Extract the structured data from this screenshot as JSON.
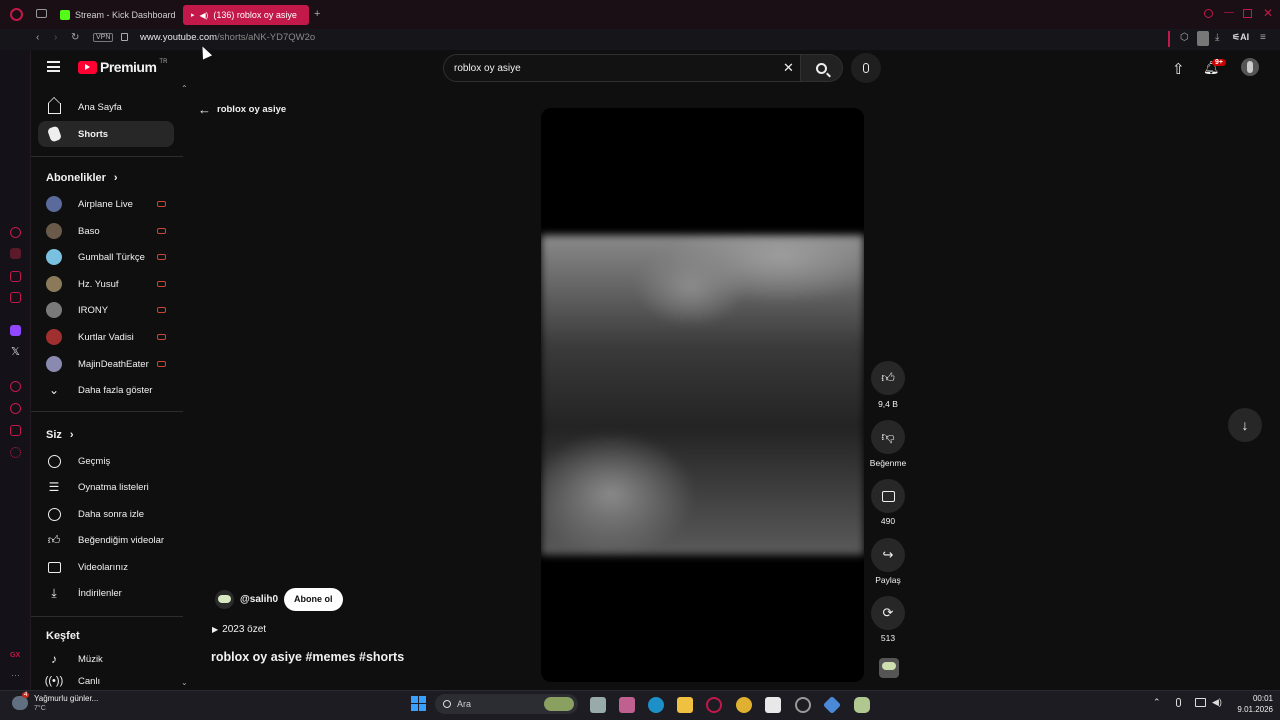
{
  "browser": {
    "tabs": [
      {
        "title": "Stream - Kick Dashboard"
      },
      {
        "title": "(136) roblox oy asiye"
      }
    ],
    "vpn_label": "VPN",
    "url_host": "www.youtube.com",
    "url_path": "/shorts/aNK-YD7QW2o",
    "ai_label": "AI"
  },
  "header": {
    "logo_text": "Premium",
    "logo_region": "TR",
    "search_value": "roblox oy asiye",
    "notification_count": "9+"
  },
  "sidebar": {
    "items": [
      {
        "label": "Ana Sayfa"
      },
      {
        "label": "Shorts"
      }
    ],
    "subscriptions_title": "Abonelikler",
    "subscriptions": [
      {
        "label": "Airplane Live",
        "color": "#5a6a9a"
      },
      {
        "label": "Baso",
        "color": "#6a5a4a"
      },
      {
        "label": "Gumball Türkçe",
        "color": "#7ac0e0"
      },
      {
        "label": "Hz. Yusuf",
        "color": "#8a7a5a"
      },
      {
        "label": "IRONY",
        "color": "#7a7a7a"
      },
      {
        "label": "Kurtlar Vadisi",
        "color": "#a03030"
      },
      {
        "label": "MajinDeathEater",
        "color": "#8a8ab0"
      }
    ],
    "show_more": "Daha fazla göster",
    "you_title": "Siz",
    "you_items": [
      {
        "label": "Geçmiş"
      },
      {
        "label": "Oynatma listeleri"
      },
      {
        "label": "Daha sonra izle"
      },
      {
        "label": "Beğendiğim videolar"
      },
      {
        "label": "Videolarınız"
      },
      {
        "label": "İndirilenler"
      }
    ],
    "explore_title": "Keşfet",
    "explore_items": [
      {
        "label": "Müzik"
      },
      {
        "label": "Canlı"
      }
    ]
  },
  "shorts": {
    "back_label": "roblox oy asiye",
    "channel": "@salih0",
    "subscribe": "Abone ol",
    "summary": "2023 özet",
    "title": "roblox oy asiye #memes #shorts",
    "likes": "9,4 B",
    "dislike_label": "Beğenme",
    "comments": "490",
    "share_label": "Paylaş",
    "remix": "513"
  },
  "taskbar": {
    "weather_title": "Yağmurlu günler...",
    "weather_temp": "7°C",
    "weather_badge": "4",
    "search_placeholder": "Ara",
    "time": "00:01",
    "date": "9.01.2026"
  },
  "colors": {
    "accent": "#c2184a",
    "yt_red": "#ff0033",
    "bg": "#0f0f0f"
  }
}
